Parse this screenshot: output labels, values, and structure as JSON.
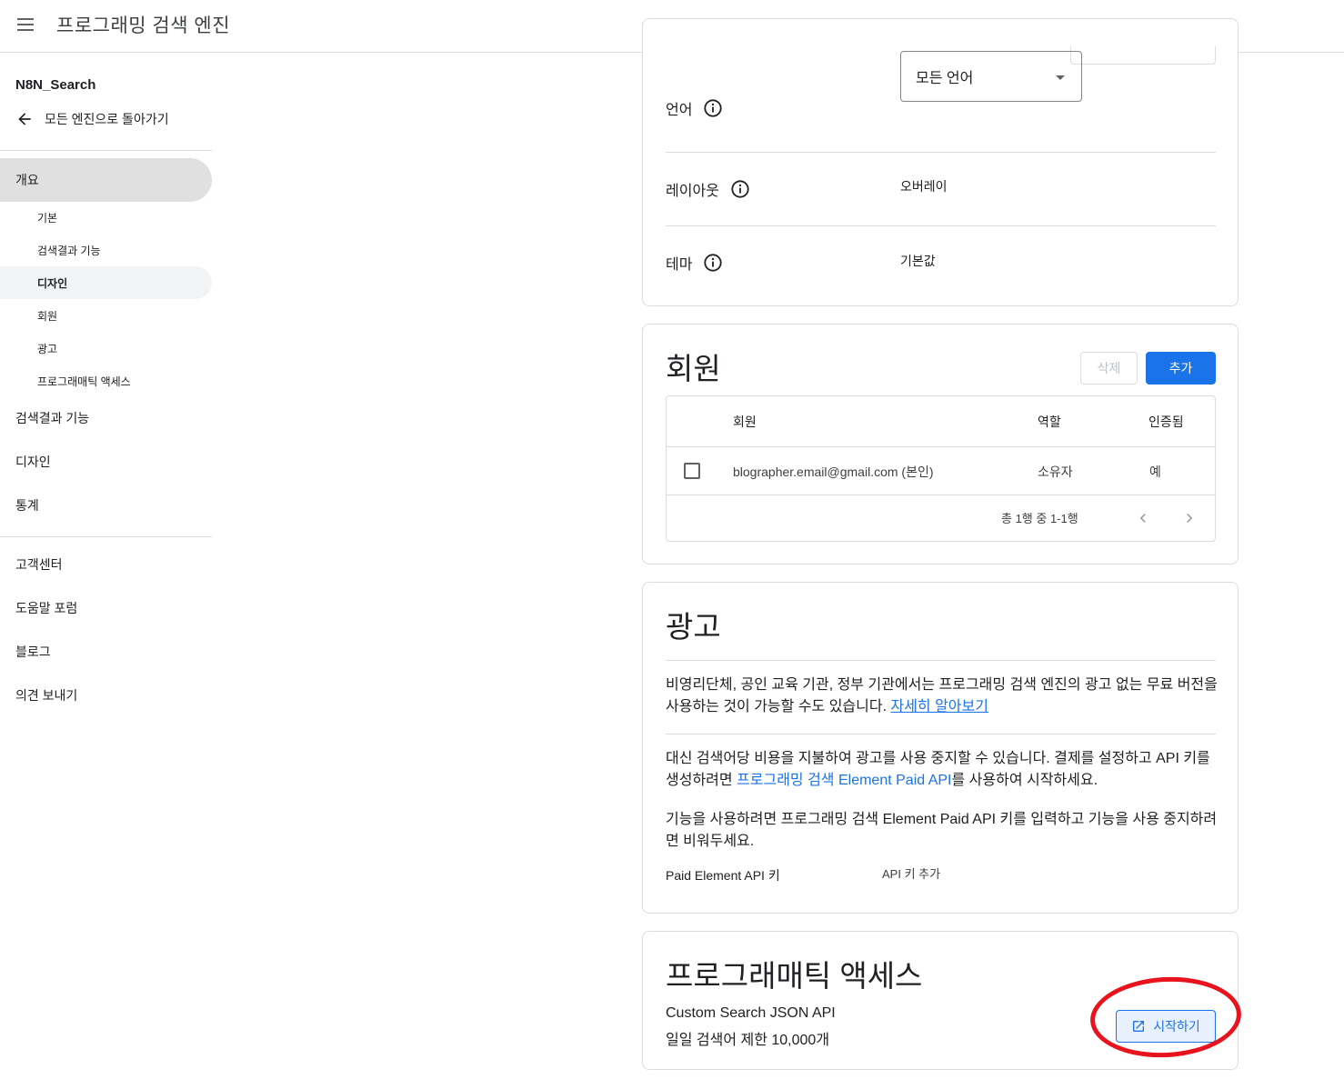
{
  "header": {
    "title": "프로그래밍 검색 엔진"
  },
  "sidebar": {
    "engine_name": "N8N_Search",
    "back_label": "모든 엔진으로 돌아가기",
    "overview": "개요",
    "sub_items": [
      "기본",
      "검색결과 기능",
      "디자인",
      "회원",
      "광고",
      "프로그래매틱 액세스"
    ],
    "items": [
      "검색결과 기능",
      "디자인",
      "통계"
    ],
    "support": [
      "고객센터",
      "도움말 포럼",
      "블로그",
      "의견 보내기"
    ]
  },
  "design_card": {
    "language_label": "언어",
    "language_value": "모든 언어",
    "layout_label": "레이아웃",
    "layout_value": "오버레이",
    "theme_label": "테마",
    "theme_value": "기본값"
  },
  "members_card": {
    "title": "회원",
    "delete_label": "삭제",
    "add_label": "추가",
    "columns": [
      "회원",
      "역할",
      "인증됨"
    ],
    "rows": [
      {
        "member": "blographer.email@gmail.com (본인)",
        "role": "소유자",
        "verified": "예"
      }
    ],
    "pager": "총 1행 중 1-1행"
  },
  "ads_card": {
    "title": "광고",
    "p1": "비영리단체, 공인 교육 기관, 정부 기관에서는 프로그래밍 검색 엔진의 광고 없는 무료 버전을 사용하는 것이 가능할 수도 있습니다.",
    "p1_link": "자세히 알아보기",
    "p2_pre": "대신 검색어당 비용을 지불하여 광고를 사용 중지할 수 있습니다. 결제를 설정하고 API 키를 생성하려면 ",
    "p2_link": "프로그래밍 검색 Element Paid API",
    "p2_post": "를 사용하여 시작하세요.",
    "p3": "기능을 사용하려면 프로그래밍 검색 Element Paid API 키를 입력하고 기능을 사용 중지하려면 비워두세요.",
    "api_key_label": "Paid Element API 키",
    "api_key_value": "API 키 추가"
  },
  "programmatic_card": {
    "title": "프로그래매틱 액세스",
    "api_name": "Custom Search JSON API",
    "limit": "일일 검색어 제한 10,000개",
    "start_label": "시작하기"
  },
  "colors": {
    "accent": "#1a73e8",
    "annotation": "#e8131c"
  }
}
